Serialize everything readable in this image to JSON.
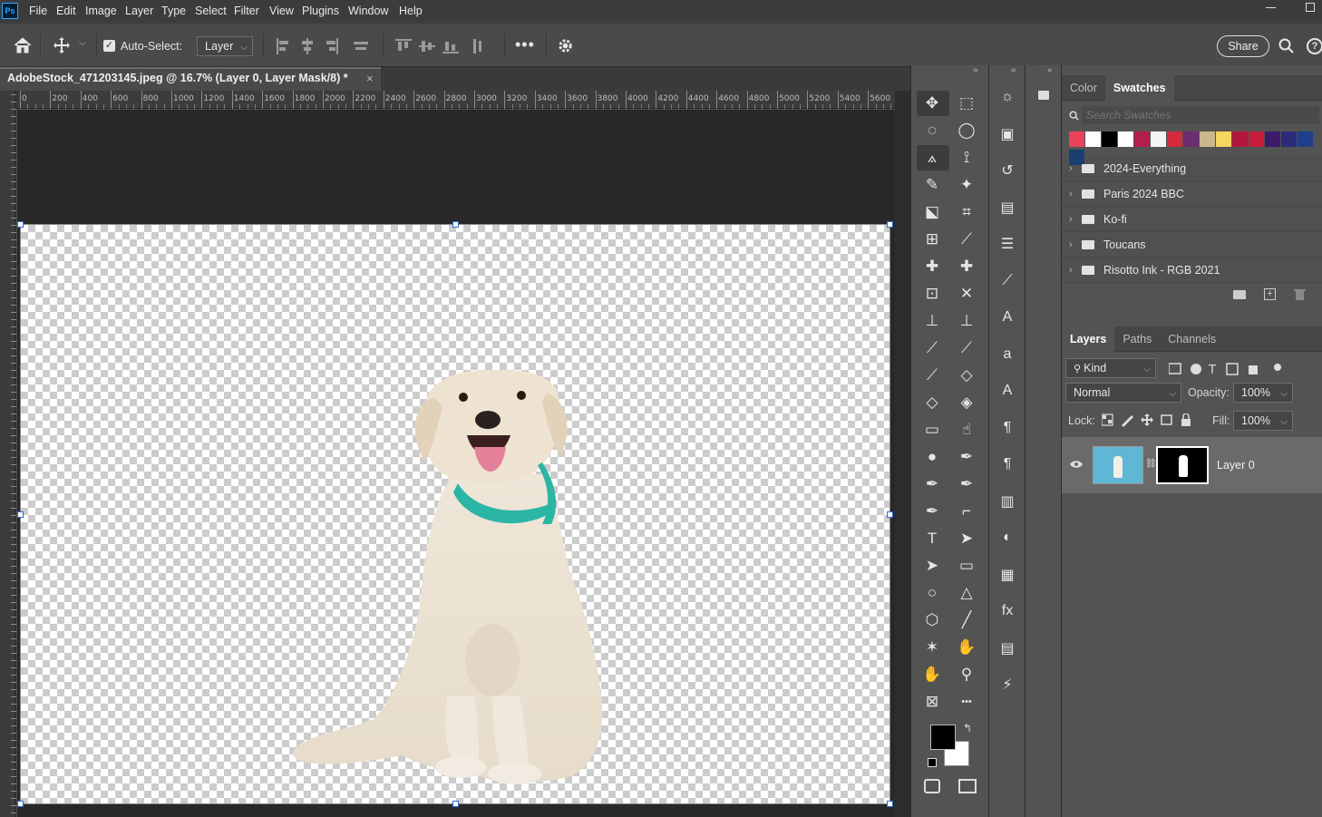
{
  "app": {
    "logo_text": "Ps"
  },
  "menu": {
    "items": [
      "File",
      "Edit",
      "Image",
      "Layer",
      "Type",
      "Select",
      "Filter",
      "View",
      "Plugins",
      "Window",
      "Help"
    ]
  },
  "options_bar": {
    "auto_select_label": "Auto-Select:",
    "auto_select_checked": true,
    "target_value": "Layer",
    "share_label": "Share"
  },
  "document": {
    "tab_title": "AdobeStock_471203145.jpeg @ 16.7% (Layer 0, Layer Mask/8) *",
    "close_glyph": "×"
  },
  "ruler": {
    "h_labels": [
      "0",
      "200",
      "400",
      "600",
      "800",
      "1000",
      "1200",
      "1400",
      "1600",
      "1800",
      "2000",
      "2200",
      "2400",
      "2600",
      "2800",
      "3000",
      "3200",
      "3400",
      "3600",
      "3800",
      "4000",
      "4200",
      "4400",
      "4600",
      "4800",
      "5000",
      "5200",
      "5400",
      "5600"
    ]
  },
  "swatches_panel": {
    "tabs": [
      "Color",
      "Swatches"
    ],
    "active_tab": "Swatches",
    "search_placeholder": "Search Swatches",
    "colors": [
      "#e8435a",
      "#ffffff",
      "#000000",
      "#ffffff",
      "#b41e4a",
      "#f4f4f4",
      "#d42a3b",
      "#6b2d6f",
      "#c8b88a",
      "#f5d660",
      "#b2173b",
      "#c81e3c",
      "#3e1a6b",
      "#2d2a7a",
      "#1e3f8c",
      "#183f6e"
    ],
    "folders": [
      "2024-Everything",
      "Paris 2024 BBC",
      "Ko-fi",
      "Toucans",
      "Risotto Ink - RGB 2021"
    ]
  },
  "layers_panel": {
    "tabs": [
      "Layers",
      "Paths",
      "Channels"
    ],
    "active_tab": "Layers",
    "filter_kind": "Kind",
    "blend_mode": "Normal",
    "opacity_label": "Opacity:",
    "opacity_value": "100%",
    "lock_label": "Lock:",
    "fill_label": "Fill:",
    "fill_value": "100%",
    "layers": [
      {
        "name": "Layer 0",
        "visible": true,
        "has_mask": true
      }
    ]
  },
  "colors": {
    "foreground": "#000000",
    "background": "#ffffff",
    "accent": "#31a8ff"
  }
}
